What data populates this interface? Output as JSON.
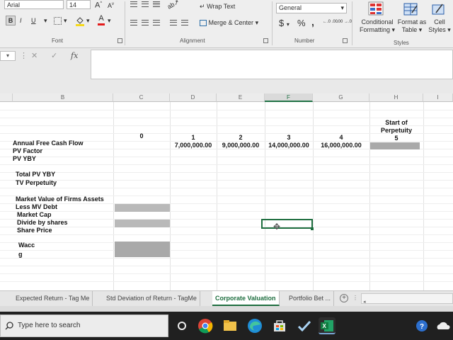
{
  "ribbon": {
    "font_name": "Arial",
    "font_size": "14",
    "grow_font": "A",
    "shrink_font": "A",
    "bold": "B",
    "italic": "I",
    "underline": "U",
    "font_color_letter": "A",
    "wrap_text": "Wrap Text",
    "merge_center": "Merge & Center",
    "number_format": "General",
    "currency": "$",
    "percent": "%",
    "comma": ",",
    "inc_decimal": "←.0 .00",
    "dec_decimal": ".00 →.0",
    "conditional_formatting_1": "Conditional",
    "conditional_formatting_2": "Formatting",
    "format_as_table_1": "Format as",
    "format_as_table_2": "Table",
    "cell_styles_1": "Cell",
    "cell_styles_2": "Styles",
    "groups": {
      "font": "Font",
      "alignment": "Alignment",
      "number": "Number",
      "styles": "Styles"
    }
  },
  "formula_bar": {
    "fx": "fx",
    "cancel": "✕",
    "enter": "✓"
  },
  "columns": [
    "B",
    "C",
    "D",
    "E",
    "F",
    "G",
    "H",
    "I"
  ],
  "sheet": {
    "period_labels": [
      "0",
      "1",
      "2",
      "3",
      "4"
    ],
    "start_perpetuity_1": "Start of",
    "start_perpetuity_2": "Perpetuity",
    "start_perpetuity_3": "5",
    "row_labels": {
      "annual_fcf": "Annual Free Cash Flow",
      "pv_factor": "PV Factor",
      "pv_yby": "PV YBY",
      "total_pv_yby": "Total PV YBY",
      "tv_perpetuity": "TV Perpetuity",
      "mv_firm_assets": "Market Value of Firms Assets",
      "less_mv_debt": "Less MV Debt",
      "market_cap": "Market Cap",
      "divide_shares": "Divide by shares",
      "share_price": "Share Price",
      "wacc": "Wacc",
      "g": "g"
    },
    "fcf_values": [
      "7,000,000.00",
      "9,000,000.00",
      "14,000,000.00",
      "16,000,000.00"
    ]
  },
  "tabs": [
    {
      "label": "Expected Return - Tag Me"
    },
    {
      "label": "Std Deviation of Return - TagMe"
    },
    {
      "label": "Corporate Valuation"
    },
    {
      "label": "Portfolio Bet ..."
    }
  ],
  "active_tab": "Corporate Valuation",
  "taskbar": {
    "search_placeholder": "Type here to search"
  },
  "colors": {
    "excel_green": "#217346",
    "shaded_cell": "#a9a9a9",
    "taskbar": "#202020"
  }
}
